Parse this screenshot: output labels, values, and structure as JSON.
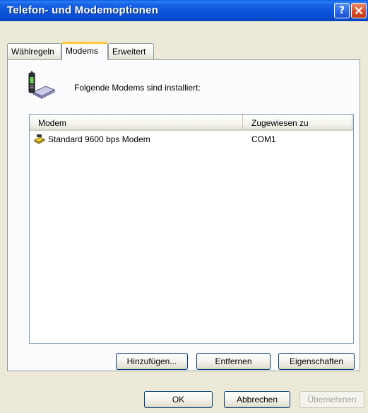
{
  "window": {
    "title": "Telefon- und Modemoptionen",
    "help_icon": "help-icon",
    "close_icon": "close-icon"
  },
  "tabs": [
    {
      "label": "Wählregeln",
      "active": false
    },
    {
      "label": "Modems",
      "active": true
    },
    {
      "label": "Erweitert",
      "active": false
    }
  ],
  "panel": {
    "icon": "modem-phone-icon",
    "info_text": "Folgende Modems sind installiert:",
    "list": {
      "columns": [
        "Modem",
        "Zugewiesen zu"
      ],
      "rows": [
        {
          "icon": "modem-icon",
          "name": "Standard  9600 bps Modem",
          "port": "COM1"
        }
      ]
    },
    "buttons": {
      "add": "Hinzufügen...",
      "remove": "Entfernen",
      "properties": "Eigenschaften"
    }
  },
  "footer": {
    "ok": "OK",
    "cancel": "Abbrechen",
    "apply": "Übernehmen",
    "apply_enabled": false
  },
  "colors": {
    "titlebar": "#0a4ccd",
    "dialog_bg": "#ece9d8",
    "active_tab_accent": "#ffc83c",
    "button_border": "#003c74"
  }
}
